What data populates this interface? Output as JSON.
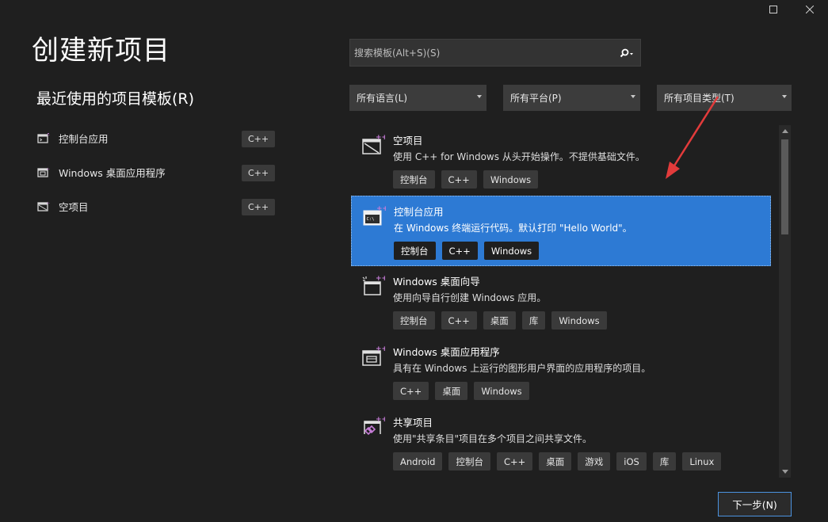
{
  "window": {
    "maximize_glyph": "□",
    "close_glyph": "✕"
  },
  "header": {
    "title": "创建新项目",
    "recent_title": "最近使用的项目模板(R)"
  },
  "recent": [
    {
      "label": "控制台应用",
      "tag": "C++",
      "icon": "console-app-icon"
    },
    {
      "label": "Windows 桌面应用程序",
      "tag": "C++",
      "icon": "desktop-app-icon"
    },
    {
      "label": "空项目",
      "tag": "C++",
      "icon": "empty-project-icon"
    }
  ],
  "search": {
    "placeholder": "搜索模板(Alt+S)(S)",
    "value": ""
  },
  "filters": {
    "language": "所有语言(L)",
    "platform": "所有平台(P)",
    "project_type": "所有项目类型(T)"
  },
  "templates": [
    {
      "name": "空项目",
      "desc": "使用 C++ for Windows 从头开始操作。不提供基础文件。",
      "tags": [
        "控制台",
        "C++",
        "Windows"
      ],
      "selected": false
    },
    {
      "name": "控制台应用",
      "desc": "在 Windows 终端运行代码。默认打印 \"Hello World\"。",
      "tags": [
        "控制台",
        "C++",
        "Windows"
      ],
      "selected": true
    },
    {
      "name": "Windows 桌面向导",
      "desc": "使用向导自行创建 Windows 应用。",
      "tags": [
        "控制台",
        "C++",
        "桌面",
        "库",
        "Windows"
      ],
      "selected": false
    },
    {
      "name": "Windows 桌面应用程序",
      "desc": "具有在 Windows 上运行的图形用户界面的应用程序的项目。",
      "tags": [
        "C++",
        "桌面",
        "Windows"
      ],
      "selected": false
    },
    {
      "name": "共享项目",
      "desc": "使用\"共享条目\"项目在多个项目之间共享文件。",
      "tags": [
        "Android",
        "控制台",
        "C++",
        "桌面",
        "游戏",
        "iOS",
        "库",
        "Linux"
      ],
      "selected": false
    }
  ],
  "footer": {
    "next_label": "下一步(N)"
  },
  "colors": {
    "accent": "#2d7ad4",
    "background": "#1f1f1f",
    "annotation": "#e23b3b"
  }
}
